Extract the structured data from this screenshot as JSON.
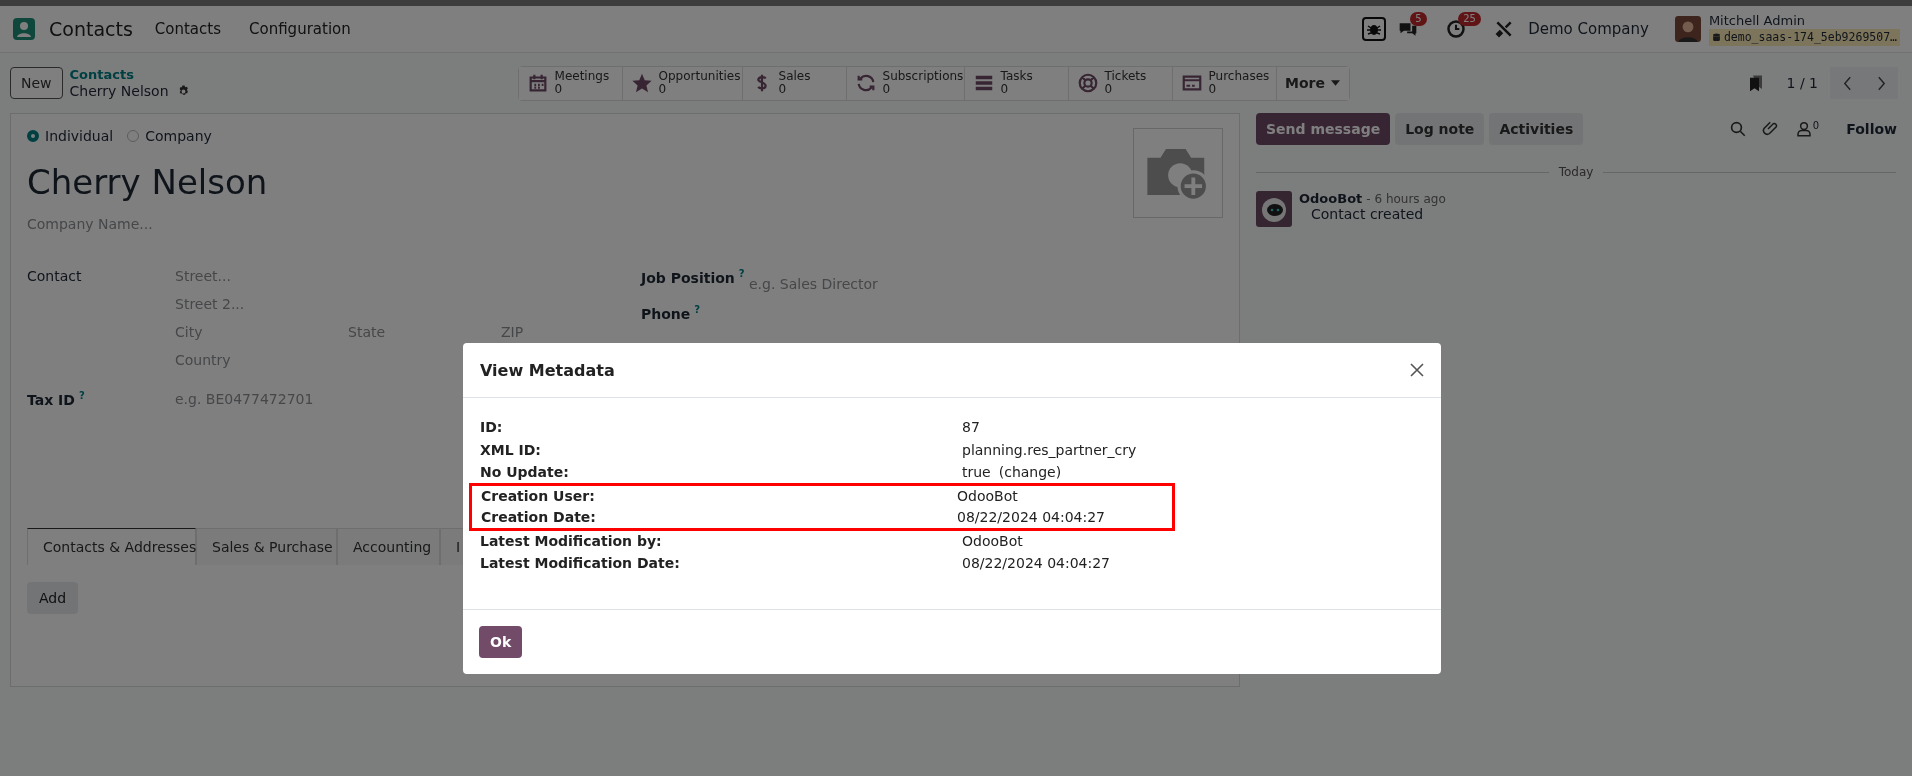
{
  "navbar": {
    "app_name": "Contacts",
    "menu": [
      "Contacts",
      "Configuration"
    ],
    "message_count": "5",
    "activity_count": "25",
    "company": "Demo Company",
    "user": "Mitchell Admin",
    "database": "demo_saas-174_5eb9269507…"
  },
  "control_panel": {
    "new_button": "New",
    "breadcrumb": "Contacts",
    "record": "Cherry Nelson",
    "smart_buttons": [
      {
        "label": "Meetings",
        "value": "0"
      },
      {
        "label": "Opportunities",
        "value": "0"
      },
      {
        "label": "Sales",
        "value": "0"
      },
      {
        "label": "Subscriptions",
        "value": "0"
      },
      {
        "label": "Tasks",
        "value": "0"
      },
      {
        "label": "Tickets",
        "value": "0"
      },
      {
        "label": "Purchases",
        "value": "0"
      }
    ],
    "more": "More",
    "pager": "1 / 1"
  },
  "form": {
    "company_types": [
      {
        "label": "Individual",
        "selected": true
      },
      {
        "label": "Company",
        "selected": false
      }
    ],
    "name": "Cherry Nelson",
    "company_placeholder": "Company Name...",
    "contact_label": "Contact",
    "address": {
      "street": {
        "placeholder": "Street..."
      },
      "street2": {
        "placeholder": "Street 2..."
      },
      "city": {
        "placeholder": "City"
      },
      "state": {
        "placeholder": "State"
      },
      "zip": {
        "placeholder": "ZIP"
      },
      "country": {
        "placeholder": "Country"
      }
    },
    "tax_id": {
      "label": "Tax ID",
      "help": "?",
      "placeholder": "e.g. BE0477472701"
    },
    "job_position": {
      "label": "Job Position",
      "help": "?",
      "placeholder": "e.g. Sales Director"
    },
    "phone": {
      "label": "Phone",
      "help": "?"
    },
    "tabs": [
      {
        "label": "Contacts & Addresses",
        "selected": true
      },
      {
        "label": "Sales & Purchase",
        "selected": false
      },
      {
        "label": "Accounting",
        "selected": false
      },
      {
        "label": "I",
        "selected": false
      }
    ],
    "add_button": "Add"
  },
  "chatter": {
    "buttons": [
      {
        "label": "Send message",
        "kind": "primary"
      },
      {
        "label": "Log note",
        "kind": "secondary"
      },
      {
        "label": "Activities",
        "kind": "secondary"
      }
    ],
    "follower_count": "0",
    "follow": "Follow",
    "date_separator": "Today",
    "messages": [
      {
        "author": "OdooBot",
        "time": "- 6 hours ago",
        "body": "Contact created"
      }
    ]
  },
  "dialog": {
    "title": "View Metadata",
    "rows": [
      {
        "label": "ID:",
        "value": "87",
        "highlighted": false
      },
      {
        "label": "XML ID:",
        "value": "planning.res_partner_cry",
        "highlighted": false
      },
      {
        "label": "No Update:",
        "value": "true",
        "link": "(change)",
        "highlighted": false
      },
      {
        "label": "Creation User:",
        "value": "OdooBot",
        "highlighted": true
      },
      {
        "label": "Creation Date:",
        "value": "08/22/2024 04:04:27",
        "highlighted": true
      },
      {
        "label": "Latest Modification by:",
        "value": "OdooBot",
        "highlighted": false
      },
      {
        "label": "Latest Modification Date:",
        "value": "08/22/2024 04:04:27",
        "highlighted": false
      }
    ],
    "ok_button": "Ok"
  }
}
